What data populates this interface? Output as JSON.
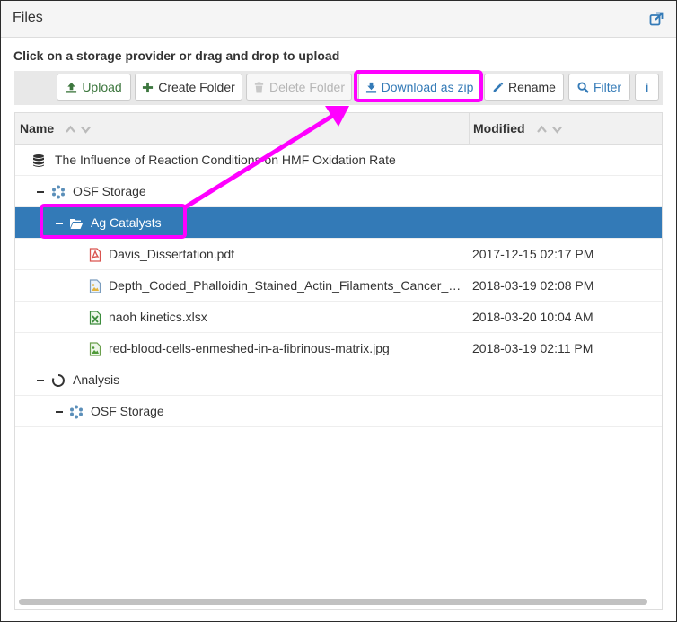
{
  "panel": {
    "title": "Files",
    "external_icon": "external-link-icon"
  },
  "instruction": "Click on a storage provider or drag and drop to upload",
  "toolbar": {
    "upload": "Upload",
    "create_folder": "Create Folder",
    "delete_folder": "Delete Folder",
    "download_zip": "Download as zip",
    "rename": "Rename",
    "filter": "Filter",
    "info": "i"
  },
  "columns": {
    "name": "Name",
    "modified": "Modified"
  },
  "tree": {
    "project": "The Influence of Reaction Conditions on HMF Oxidation Rate",
    "storage1": "OSF Storage",
    "folder": "Ag Catalysts",
    "files": [
      {
        "name": "Davis_Dissertation.pdf",
        "modified": "2017-12-15 02:17 PM",
        "icon": "pdf-file-icon"
      },
      {
        "name": "Depth_Coded_Phalloidin_Stained_Actin_Filaments_Cancer_Cells.jpg",
        "modified": "2018-03-19 02:08 PM",
        "icon": "image-file-icon"
      },
      {
        "name": "naoh kinetics.xlsx",
        "modified": "2018-03-20 10:04 AM",
        "icon": "excel-file-icon"
      },
      {
        "name": "red-blood-cells-enmeshed-in-a-fibrinous-matrix.jpg",
        "modified": "2018-03-19 02:11 PM",
        "icon": "image-file-icon"
      }
    ],
    "component": "Analysis",
    "storage2": "OSF Storage"
  },
  "colors": {
    "selected_row": "#337ab7",
    "annotation": "#ff00ff",
    "toolbar_bg": "#e8e8e8"
  }
}
